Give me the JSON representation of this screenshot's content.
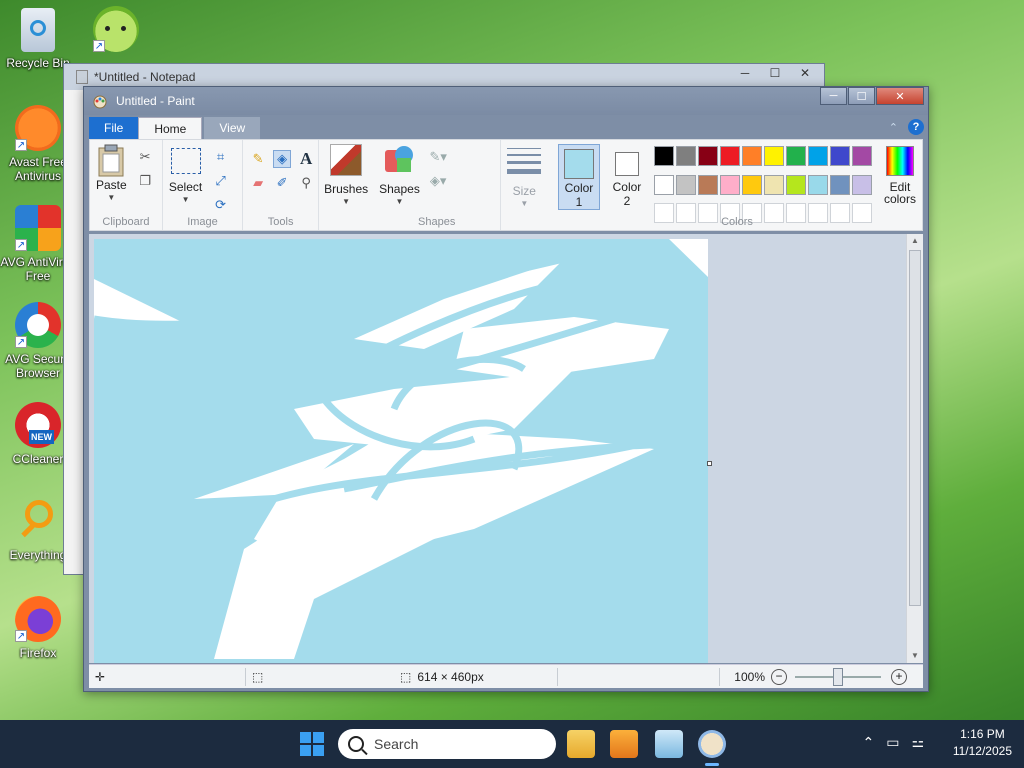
{
  "desktop": {
    "icons": [
      {
        "label": "Recycle Bin",
        "icon": "recycle-bin-icon"
      },
      {
        "label": "",
        "icon": "lime-app-icon"
      },
      {
        "label": "Avast Free Antivirus",
        "icon": "avast-icon"
      },
      {
        "label": "AVG AntiVirus Free",
        "icon": "avg-icon"
      },
      {
        "label": "AVG Secure Browser",
        "icon": "avg-browser-icon"
      },
      {
        "label": "CCleaner",
        "icon": "ccleaner-icon",
        "badge": "NEW"
      },
      {
        "label": "Everything",
        "icon": "everything-icon"
      },
      {
        "label": "Firefox",
        "icon": "firefox-icon"
      }
    ]
  },
  "notepad": {
    "title": "*Untitled - Notepad"
  },
  "paint": {
    "title": "Untitled - Paint",
    "tabs": {
      "file": "File",
      "home": "Home",
      "view": "View"
    },
    "help": "?",
    "clipboard": {
      "paste": "Paste",
      "label": "Clipboard"
    },
    "image": {
      "select": "Select",
      "label": "Image"
    },
    "tools": {
      "label": "Tools",
      "text_tool": "A"
    },
    "brushes": {
      "label": "Brushes"
    },
    "shapes": {
      "button": "Shapes",
      "label": "Shapes"
    },
    "size": {
      "label": "Size"
    },
    "color1": {
      "line1": "Color",
      "line2": "1",
      "value": "#a4dcec"
    },
    "color2": {
      "line1": "Color",
      "line2": "2",
      "value": "#ffffff"
    },
    "colors_label": "Colors",
    "edit_colors": {
      "line1": "Edit",
      "line2": "colors"
    },
    "palette_row1": [
      "#000000",
      "#7f7f7f",
      "#880015",
      "#ed1c24",
      "#ff7f27",
      "#fff200",
      "#22b14c",
      "#00a2e8",
      "#3f48cc",
      "#a349a4"
    ],
    "palette_row2": [
      "#ffffff",
      "#c3c3c3",
      "#b97a57",
      "#ffaec9",
      "#ffc90e",
      "#efe4b0",
      "#b5e61d",
      "#99d9ea",
      "#7092be",
      "#c8bfe7"
    ],
    "status": {
      "dimensions": "614 × 460px",
      "zoom": "100%",
      "zoom_level": 100
    }
  },
  "taskbar": {
    "search_placeholder": "Search",
    "time": "1:16 PM",
    "date": "11/12/2025"
  }
}
